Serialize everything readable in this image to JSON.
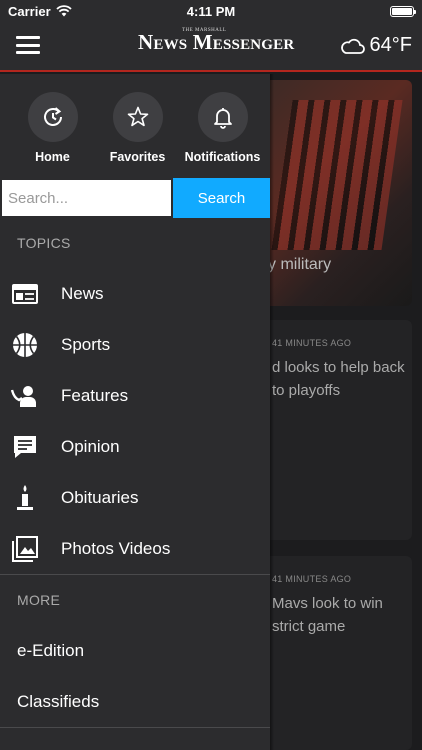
{
  "status_bar": {
    "carrier": "Carrier",
    "time": "4:11 PM"
  },
  "header": {
    "logo_small": "THE MARSHALL",
    "logo": "News Messenger",
    "weather_temp": "64°F"
  },
  "quick_actions": [
    {
      "label": "Home",
      "icon": "refresh-clock-icon"
    },
    {
      "label": "Favorites",
      "icon": "star-icon"
    },
    {
      "label": "Notifications",
      "icon": "bell-icon"
    }
  ],
  "search": {
    "placeholder": "Search...",
    "button_label": "Search"
  },
  "topics": {
    "heading": "TOPICS",
    "items": [
      {
        "label": "News",
        "icon": "newspaper-icon"
      },
      {
        "label": "Sports",
        "icon": "basketball-icon"
      },
      {
        "label": "Features",
        "icon": "person-icon"
      },
      {
        "label": "Opinion",
        "icon": "comment-icon"
      },
      {
        "label": "Obituaries",
        "icon": "candle-icon"
      },
      {
        "label": "Photos Videos",
        "icon": "photos-icon"
      }
    ]
  },
  "more": {
    "heading": "MORE",
    "items": [
      {
        "label": "e-Edition"
      },
      {
        "label": "Classifieds"
      }
    ]
  },
  "background_cards": [
    {
      "caption": "y military"
    },
    {
      "meta": "41 MINUTES AGO",
      "headline": "d looks to help back to playoffs"
    },
    {
      "meta": "41 MINUTES AGO",
      "headline": "Mavs look to win strict game"
    }
  ],
  "colors": {
    "accent": "#11aaff",
    "header_rule": "#b3261e",
    "drawer_bg": "#2c2c2e"
  }
}
